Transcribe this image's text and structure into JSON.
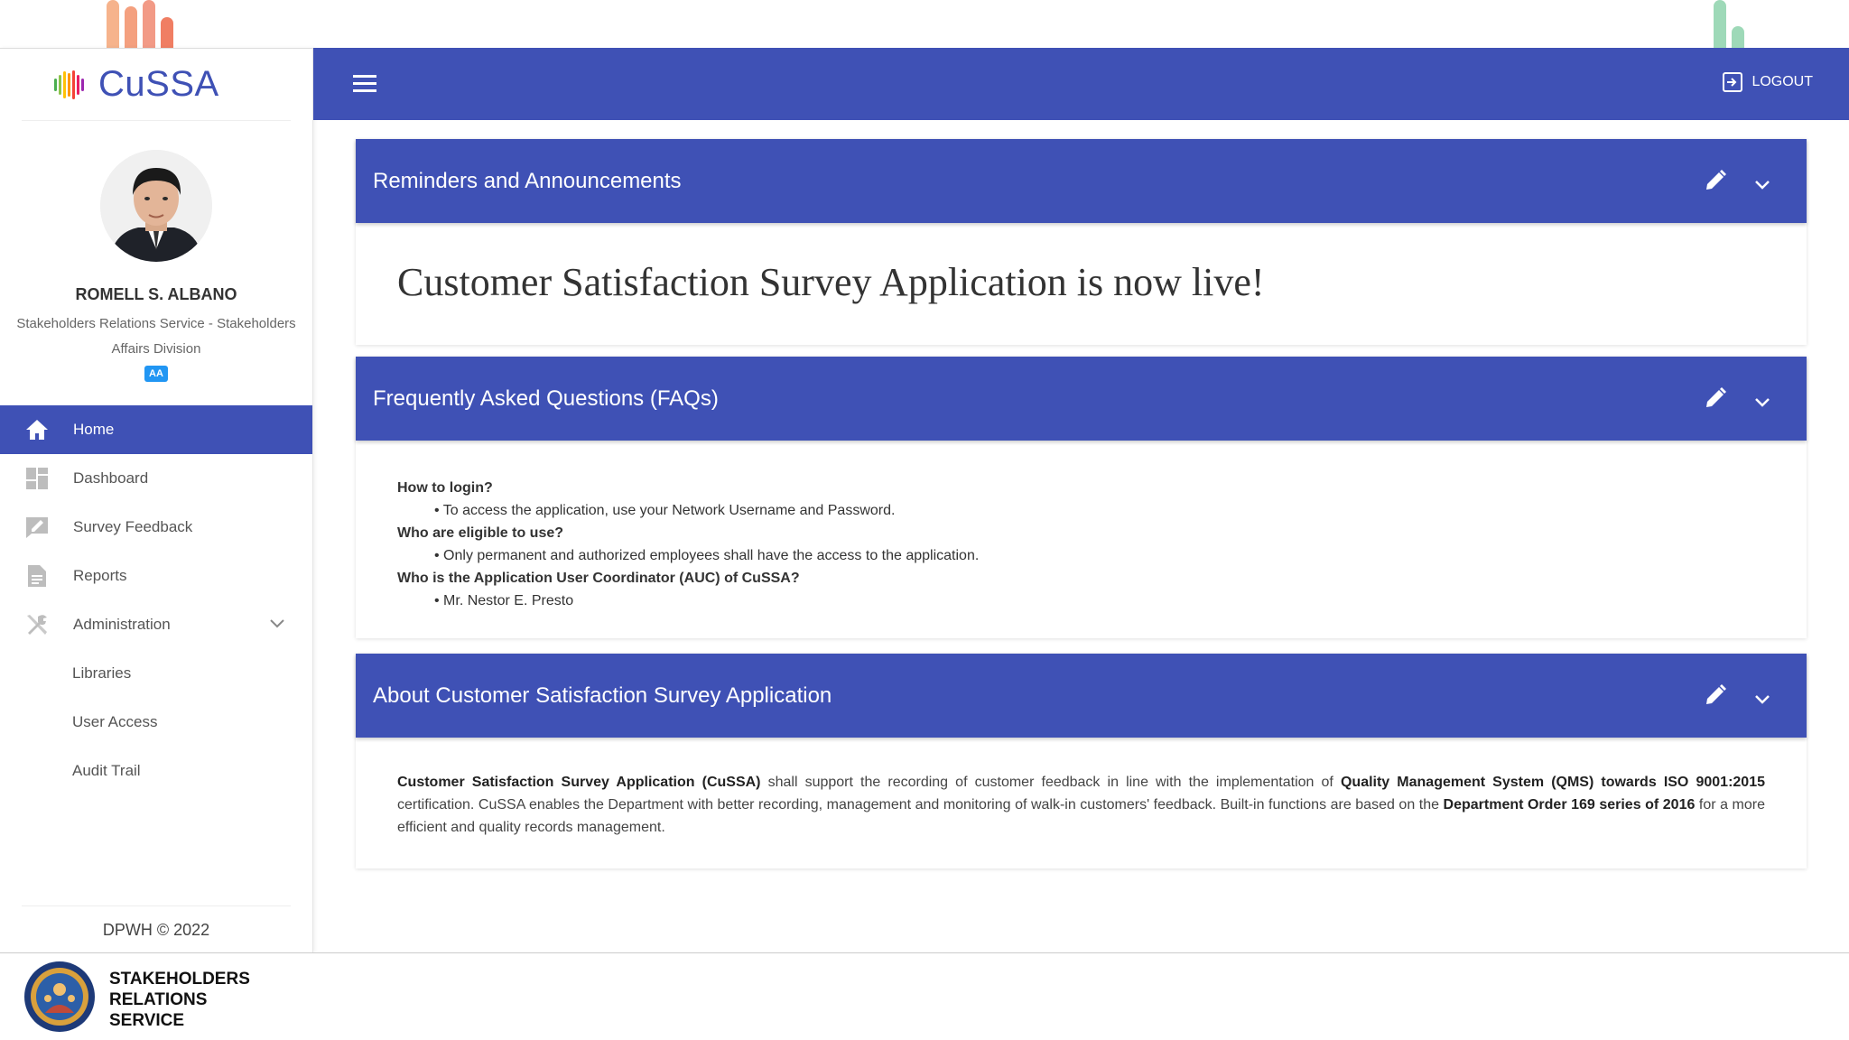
{
  "app": {
    "name": "CuSSA"
  },
  "header": {
    "logout_label": "LOGOUT"
  },
  "user": {
    "name": "ROMELL S. ALBANO",
    "department": "Stakeholders Relations Service - Stakeholders Affairs Division",
    "role_badge": "AA"
  },
  "nav": {
    "items": [
      {
        "label": "Home",
        "icon": "home-icon",
        "active": true
      },
      {
        "label": "Dashboard",
        "icon": "dashboard-icon"
      },
      {
        "label": "Survey Feedback",
        "icon": "feedback-icon"
      },
      {
        "label": "Reports",
        "icon": "document-icon"
      },
      {
        "label": "Administration",
        "icon": "tools-icon",
        "expanded": true
      }
    ],
    "sub_items": [
      {
        "label": "Libraries"
      },
      {
        "label": "User Access"
      },
      {
        "label": "Audit Trail"
      }
    ]
  },
  "sidebar_footer": "DPWH © 2022",
  "cards": {
    "reminders": {
      "title": "Reminders and Announcements",
      "content": "Customer Satisfaction Survey Application is now live!"
    },
    "faqs": {
      "title": "Frequently Asked Questions (FAQs)",
      "items": [
        {
          "q": "How to login?",
          "a": "• To access the application, use your Network Username and Password."
        },
        {
          "q": "Who are eligible to use?",
          "a": "• Only permanent and authorized employees shall have the access to the application."
        },
        {
          "q": "Who is the Application User Coordinator (AUC) of CuSSA?",
          "a": "• Mr. Nestor E. Presto"
        }
      ]
    },
    "about": {
      "title": "About Customer Satisfaction Survey Application",
      "b1": "Customer Satisfaction Survey Application (CuSSA)",
      "t1": " shall support the recording of customer feedback in line with the implementation of ",
      "b2": "Quality Management System (QMS) towards ISO 9001:2015",
      "t2": " certification. CuSSA enables the Department with better recording, management and monitoring of walk-in customers' feedback. Built-in functions are based on the ",
      "b3": "Department Order 169 series of 2016",
      "t3": " for a more efficient and quality records management."
    }
  },
  "footer": {
    "org_line1": "STAKEHOLDERS",
    "org_line2": "RELATIONS",
    "org_line3": "SERVICE"
  },
  "colors": {
    "primary": "#3f51b5",
    "badge": "#2196f3"
  }
}
